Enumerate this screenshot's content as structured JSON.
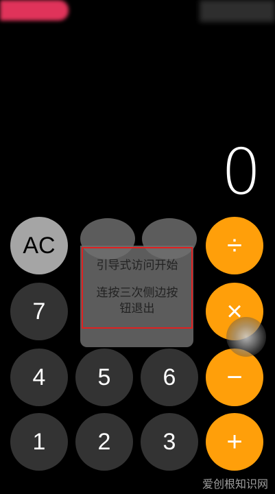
{
  "display": {
    "value": "0"
  },
  "keys": {
    "ac": "AC",
    "divide": "÷",
    "multiply": "×",
    "minus": "−",
    "plus": "+",
    "seven": "7",
    "four": "4",
    "five": "5",
    "six": "6",
    "one": "1",
    "two": "2",
    "three": "3"
  },
  "dialog": {
    "title": "引导式访问开始",
    "message_line1": "连按三次侧边按",
    "message_line2": "钮退出"
  },
  "watermark": {
    "text": "爱创根知识网"
  },
  "colors": {
    "orange": "#ff9f0a",
    "light_gray": "#a5a5a5",
    "dark_gray": "#333333"
  }
}
